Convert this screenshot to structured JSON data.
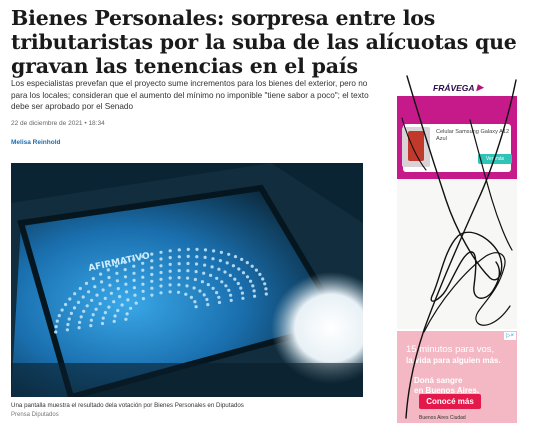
{
  "article": {
    "headline": "Bienes Personales: sorpresa entre los tributaristas por la suba de las alícuotas que gravan las tenencias en el país",
    "lead": "Los especialistas prevefan que el proyecto sume incrementos para los bienes del exterior, pero no para los locales; consideran que el aumento del mínimo no imponible \"tiene sabor a poco\"; el texto debe ser aprobado por el Senado",
    "dateline": "22 de diciembre de 2021 • 18:34",
    "author": "Melisa Reinhold",
    "image_caption": "Una pantalla muestra el resultado dela votación por Bienes Personales en Diputados",
    "image_credit": "Prensa Diputados",
    "screen_label": "AFIRMATIVO"
  },
  "ads": {
    "top": {
      "brand": "FRÁVEGA",
      "brand_mark": "▶",
      "product_name": "Celular Samsung Galaxy A12 Azul",
      "buy_label": "Ver más"
    },
    "bottom": {
      "line1": "15 minutos para vos,",
      "line2": "la vida para alguien más.",
      "line3": "Doná sangre",
      "line4": "en Buenos Aires.",
      "cta_label": "Conocé más",
      "footer": "Buenos Aires Ciudad",
      "adchoices": "▷×"
    }
  },
  "colors": {
    "author_link": "#1a6eb0",
    "ad_magenta": "#c71a8a",
    "ad_pink": "#f3b8c4",
    "cta_red": "#e4194b",
    "screen_blue": "#1f8fd6"
  }
}
